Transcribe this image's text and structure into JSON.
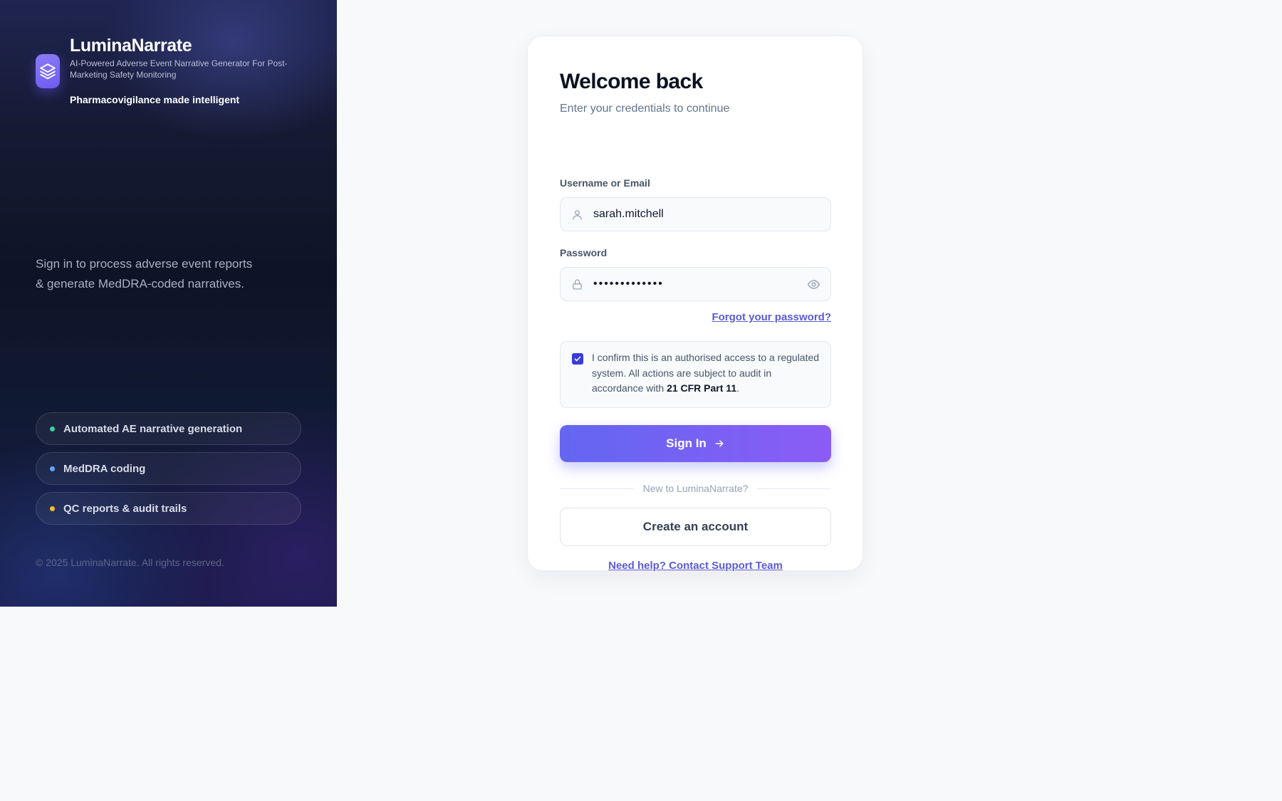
{
  "brand": {
    "name": "LuminaNarrate",
    "description": "AI-Powered Adverse Event Narrative Generator For Post-Marketing Safety Monitoring",
    "slogan": "Pharmacovigilance made intelligent",
    "intro_line1": "Sign in to process adverse event reports",
    "intro_line2": "& generate MedDRA-coded narratives.",
    "features": [
      {
        "label": "Automated AE narrative generation",
        "dot_color": "#34d399"
      },
      {
        "label": "MedDRA coding",
        "dot_color": "#60a5fa"
      },
      {
        "label": "QC reports & audit trails",
        "dot_color": "#fbbf24"
      }
    ],
    "copyright": "© 2025 LuminaNarrate. All rights reserved.",
    "logo_icon": "layers-icon"
  },
  "login": {
    "title": "Welcome back",
    "subtitle": "Enter your credentials to continue",
    "username": {
      "label": "Username or Email",
      "value": "sarah.mitchell",
      "icon": "user-icon"
    },
    "password": {
      "label": "Password",
      "value": "•••••••••••••",
      "icon": "lock-icon",
      "toggle_icon": "eye-icon"
    },
    "forgot_link": "Forgot your password?",
    "confirm": {
      "checked": true,
      "text_before": "I confirm this is an authorised access to a regulated system. All actions are subject to audit in accordance with ",
      "regulation": "21 CFR Part 11",
      "text_after": "."
    },
    "signin_label": "Sign In",
    "signin_icon": "arrow-right-icon",
    "divider_text": "New to LuminaNarrate?",
    "create_account_label": "Create an account",
    "help_link": "Need help? Contact Support Team"
  },
  "colors": {
    "accent": "#6366f1",
    "accent_end": "#8b5cf6",
    "link": "#5b5bd6"
  }
}
